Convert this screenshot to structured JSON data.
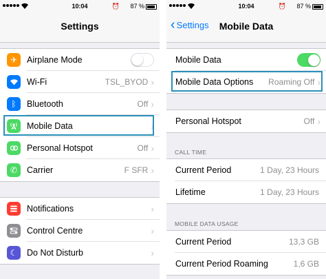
{
  "status": {
    "time": "10:04",
    "battery": "87 %",
    "carrier_wifi": "wifi"
  },
  "left": {
    "title": "Settings",
    "group1": [
      {
        "label": "Airplane Mode",
        "icon": "airplane-icon",
        "color": "#ff9500",
        "control": "toggle-off"
      },
      {
        "label": "Wi-Fi",
        "value": "TSL_BYOD",
        "icon": "wifi-icon",
        "color": "#007aff"
      },
      {
        "label": "Bluetooth",
        "value": "Off",
        "icon": "bluetooth-icon",
        "color": "#007aff"
      },
      {
        "label": "Mobile Data",
        "value": "",
        "icon": "antenna-icon",
        "color": "#4cd964"
      },
      {
        "label": "Personal Hotspot",
        "value": "Off",
        "icon": "hotspot-icon",
        "color": "#4cd964"
      },
      {
        "label": "Carrier",
        "value": "F SFR",
        "icon": "phone-icon",
        "color": "#4cd964"
      }
    ],
    "group2": [
      {
        "label": "Notifications",
        "icon": "notifications-icon",
        "color": "#ff3b30"
      },
      {
        "label": "Control Centre",
        "icon": "control-centre-icon",
        "color": "#8e8e93"
      },
      {
        "label": "Do Not Disturb",
        "icon": "moon-icon",
        "color": "#5856d6"
      }
    ]
  },
  "right": {
    "back": "Settings",
    "title": "Mobile Data",
    "mobile_data": {
      "label": "Mobile Data",
      "toggle": "on"
    },
    "mobile_data_options": {
      "label": "Mobile Data Options",
      "value": "Roaming Off"
    },
    "personal_hotspot": {
      "label": "Personal Hotspot",
      "value": "Off"
    },
    "call_time": {
      "header": "CALL TIME",
      "rows": [
        {
          "label": "Current Period",
          "value": "1 Day, 23 Hours"
        },
        {
          "label": "Lifetime",
          "value": "1 Day, 23 Hours"
        }
      ]
    },
    "usage": {
      "header": "MOBILE DATA USAGE",
      "rows": [
        {
          "label": "Current Period",
          "value": "13,3 GB"
        },
        {
          "label": "Current Period Roaming",
          "value": "1,6 GB"
        }
      ]
    }
  },
  "colors": {
    "accent": "#007aff",
    "highlight": "#2a8fb8",
    "toggle_on": "#4cd964"
  }
}
